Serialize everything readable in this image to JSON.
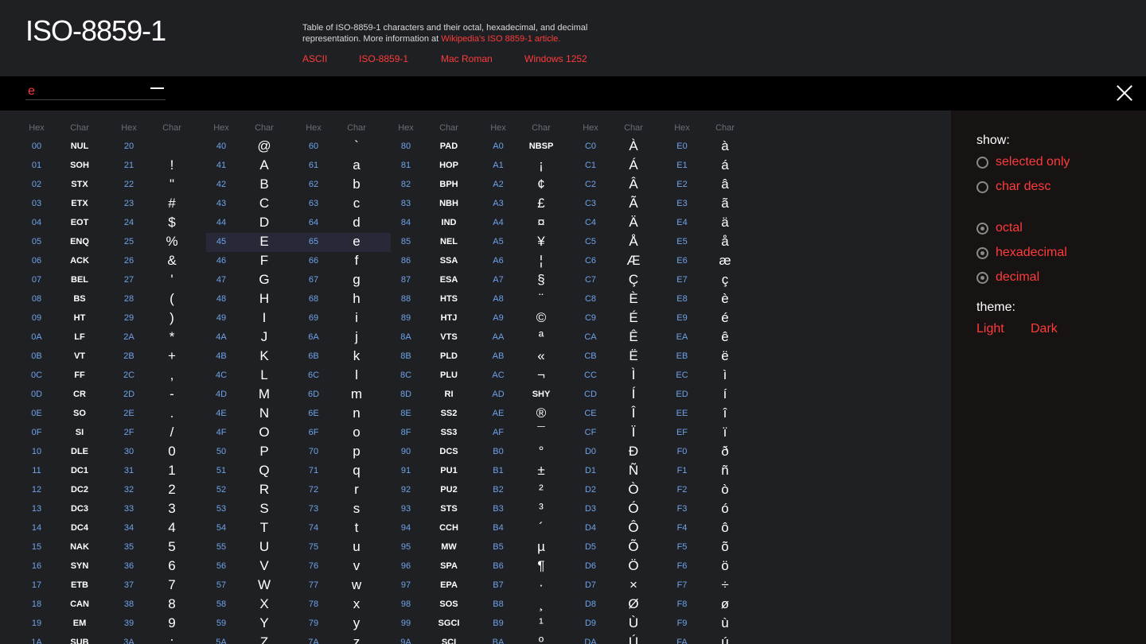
{
  "header": {
    "title": "ISO-8859-1",
    "description": "Table of ISO-8859-1 characters and their octal, hexadecimal, and decimal representation. More information at",
    "description_link": "Wikipedia's ISO 8859-1 article.",
    "links": [
      "ASCII",
      "ISO-8859-1",
      "Mac Roman",
      "Windows 1252"
    ]
  },
  "search": {
    "value": "e",
    "placeholder": ""
  },
  "table": {
    "header_hex": "Hex",
    "header_char": "Char",
    "columns": [
      [
        [
          "00",
          "NUL"
        ],
        [
          "01",
          "SOH"
        ],
        [
          "02",
          "STX"
        ],
        [
          "03",
          "ETX"
        ],
        [
          "04",
          "EOT"
        ],
        [
          "05",
          "ENQ"
        ],
        [
          "06",
          "ACK"
        ],
        [
          "07",
          "BEL"
        ],
        [
          "08",
          "BS"
        ],
        [
          "09",
          "HT"
        ],
        [
          "0A",
          "LF"
        ],
        [
          "0B",
          "VT"
        ],
        [
          "0C",
          "FF"
        ],
        [
          "0D",
          "CR"
        ],
        [
          "0E",
          "SO"
        ],
        [
          "0F",
          "SI"
        ],
        [
          "10",
          "DLE"
        ],
        [
          "11",
          "DC1"
        ],
        [
          "12",
          "DC2"
        ],
        [
          "13",
          "DC3"
        ],
        [
          "14",
          "DC4"
        ],
        [
          "15",
          "NAK"
        ],
        [
          "16",
          "SYN"
        ],
        [
          "17",
          "ETB"
        ],
        [
          "18",
          "CAN"
        ],
        [
          "19",
          "EM"
        ],
        [
          "1A",
          "SUB"
        ]
      ],
      [
        [
          "20",
          ""
        ],
        [
          "21",
          "!"
        ],
        [
          "22",
          "\""
        ],
        [
          "23",
          "#"
        ],
        [
          "24",
          "$"
        ],
        [
          "25",
          "%"
        ],
        [
          "26",
          "&"
        ],
        [
          "27",
          "'"
        ],
        [
          "28",
          "("
        ],
        [
          "29",
          ")"
        ],
        [
          "2A",
          "*"
        ],
        [
          "2B",
          "+"
        ],
        [
          "2C",
          ","
        ],
        [
          "2D",
          "-"
        ],
        [
          "2E",
          "."
        ],
        [
          "2F",
          "/"
        ],
        [
          "30",
          "0"
        ],
        [
          "31",
          "1"
        ],
        [
          "32",
          "2"
        ],
        [
          "33",
          "3"
        ],
        [
          "34",
          "4"
        ],
        [
          "35",
          "5"
        ],
        [
          "36",
          "6"
        ],
        [
          "37",
          "7"
        ],
        [
          "38",
          "8"
        ],
        [
          "39",
          "9"
        ],
        [
          "3A",
          ":"
        ]
      ],
      [
        [
          "40",
          "@"
        ],
        [
          "41",
          "A"
        ],
        [
          "42",
          "B"
        ],
        [
          "43",
          "C"
        ],
        [
          "44",
          "D"
        ],
        [
          "45",
          "E"
        ],
        [
          "46",
          "F"
        ],
        [
          "47",
          "G"
        ],
        [
          "48",
          "H"
        ],
        [
          "49",
          "I"
        ],
        [
          "4A",
          "J"
        ],
        [
          "4B",
          "K"
        ],
        [
          "4C",
          "L"
        ],
        [
          "4D",
          "M"
        ],
        [
          "4E",
          "N"
        ],
        [
          "4F",
          "O"
        ],
        [
          "50",
          "P"
        ],
        [
          "51",
          "Q"
        ],
        [
          "52",
          "R"
        ],
        [
          "53",
          "S"
        ],
        [
          "54",
          "T"
        ],
        [
          "55",
          "U"
        ],
        [
          "56",
          "V"
        ],
        [
          "57",
          "W"
        ],
        [
          "58",
          "X"
        ],
        [
          "59",
          "Y"
        ],
        [
          "5A",
          "Z"
        ]
      ],
      [
        [
          "60",
          "`"
        ],
        [
          "61",
          "a"
        ],
        [
          "62",
          "b"
        ],
        [
          "63",
          "c"
        ],
        [
          "64",
          "d"
        ],
        [
          "65",
          "e"
        ],
        [
          "66",
          "f"
        ],
        [
          "67",
          "g"
        ],
        [
          "68",
          "h"
        ],
        [
          "69",
          "i"
        ],
        [
          "6A",
          "j"
        ],
        [
          "6B",
          "k"
        ],
        [
          "6C",
          "l"
        ],
        [
          "6D",
          "m"
        ],
        [
          "6E",
          "n"
        ],
        [
          "6F",
          "o"
        ],
        [
          "70",
          "p"
        ],
        [
          "71",
          "q"
        ],
        [
          "72",
          "r"
        ],
        [
          "73",
          "s"
        ],
        [
          "74",
          "t"
        ],
        [
          "75",
          "u"
        ],
        [
          "76",
          "v"
        ],
        [
          "77",
          "w"
        ],
        [
          "78",
          "x"
        ],
        [
          "79",
          "y"
        ],
        [
          "7A",
          "z"
        ]
      ],
      [
        [
          "80",
          "PAD"
        ],
        [
          "81",
          "HOP"
        ],
        [
          "82",
          "BPH"
        ],
        [
          "83",
          "NBH"
        ],
        [
          "84",
          "IND"
        ],
        [
          "85",
          "NEL"
        ],
        [
          "86",
          "SSA"
        ],
        [
          "87",
          "ESA"
        ],
        [
          "88",
          "HTS"
        ],
        [
          "89",
          "HTJ"
        ],
        [
          "8A",
          "VTS"
        ],
        [
          "8B",
          "PLD"
        ],
        [
          "8C",
          "PLU"
        ],
        [
          "8D",
          "RI"
        ],
        [
          "8E",
          "SS2"
        ],
        [
          "8F",
          "SS3"
        ],
        [
          "90",
          "DCS"
        ],
        [
          "91",
          "PU1"
        ],
        [
          "92",
          "PU2"
        ],
        [
          "93",
          "STS"
        ],
        [
          "94",
          "CCH"
        ],
        [
          "95",
          "MW"
        ],
        [
          "96",
          "SPA"
        ],
        [
          "97",
          "EPA"
        ],
        [
          "98",
          "SOS"
        ],
        [
          "99",
          "SGCI"
        ],
        [
          "9A",
          "SCI"
        ]
      ],
      [
        [
          "A0",
          "NBSP"
        ],
        [
          "A1",
          "¡"
        ],
        [
          "A2",
          "¢"
        ],
        [
          "A3",
          "£"
        ],
        [
          "A4",
          "¤"
        ],
        [
          "A5",
          "¥"
        ],
        [
          "A6",
          "¦"
        ],
        [
          "A7",
          "§"
        ],
        [
          "A8",
          "¨"
        ],
        [
          "A9",
          "©"
        ],
        [
          "AA",
          "ª"
        ],
        [
          "AB",
          "«"
        ],
        [
          "AC",
          "¬"
        ],
        [
          "AD",
          "SHY"
        ],
        [
          "AE",
          "®"
        ],
        [
          "AF",
          "¯"
        ],
        [
          "B0",
          "°"
        ],
        [
          "B1",
          "±"
        ],
        [
          "B2",
          "²"
        ],
        [
          "B3",
          "³"
        ],
        [
          "B4",
          "´"
        ],
        [
          "B5",
          "µ"
        ],
        [
          "B6",
          "¶"
        ],
        [
          "B7",
          "·"
        ],
        [
          "B8",
          "¸"
        ],
        [
          "B9",
          "¹"
        ],
        [
          "BA",
          "º"
        ]
      ],
      [
        [
          "C0",
          "À"
        ],
        [
          "C1",
          "Á"
        ],
        [
          "C2",
          "Â"
        ],
        [
          "C3",
          "Ã"
        ],
        [
          "C4",
          "Ä"
        ],
        [
          "C5",
          "Å"
        ],
        [
          "C6",
          "Æ"
        ],
        [
          "C7",
          "Ç"
        ],
        [
          "C8",
          "È"
        ],
        [
          "C9",
          "É"
        ],
        [
          "CA",
          "Ê"
        ],
        [
          "CB",
          "Ë"
        ],
        [
          "CC",
          "Ì"
        ],
        [
          "CD",
          "Í"
        ],
        [
          "CE",
          "Î"
        ],
        [
          "CF",
          "Ï"
        ],
        [
          "D0",
          "Ð"
        ],
        [
          "D1",
          "Ñ"
        ],
        [
          "D2",
          "Ò"
        ],
        [
          "D3",
          "Ó"
        ],
        [
          "D4",
          "Ô"
        ],
        [
          "D5",
          "Õ"
        ],
        [
          "D6",
          "Ö"
        ],
        [
          "D7",
          "×"
        ],
        [
          "D8",
          "Ø"
        ],
        [
          "D9",
          "Ù"
        ],
        [
          "DA",
          "Ú"
        ]
      ],
      [
        [
          "E0",
          "à"
        ],
        [
          "E1",
          "á"
        ],
        [
          "E2",
          "â"
        ],
        [
          "E3",
          "ã"
        ],
        [
          "E4",
          "ä"
        ],
        [
          "E5",
          "å"
        ],
        [
          "E6",
          "æ"
        ],
        [
          "E7",
          "ç"
        ],
        [
          "E8",
          "è"
        ],
        [
          "E9",
          "é"
        ],
        [
          "EA",
          "ê"
        ],
        [
          "EB",
          "ë"
        ],
        [
          "EC",
          "ì"
        ],
        [
          "ED",
          "í"
        ],
        [
          "EE",
          "î"
        ],
        [
          "EF",
          "ï"
        ],
        [
          "F0",
          "ð"
        ],
        [
          "F1",
          "ñ"
        ],
        [
          "F2",
          "ò"
        ],
        [
          "F3",
          "ó"
        ],
        [
          "F4",
          "ô"
        ],
        [
          "F5",
          "õ"
        ],
        [
          "F6",
          "ö"
        ],
        [
          "F7",
          "÷"
        ],
        [
          "F8",
          "ø"
        ],
        [
          "F9",
          "ù"
        ],
        [
          "FA",
          "ú"
        ]
      ]
    ],
    "control_names": [
      "NUL",
      "SOH",
      "STX",
      "ETX",
      "EOT",
      "ENQ",
      "ACK",
      "BEL",
      "BS",
      "HT",
      "LF",
      "VT",
      "FF",
      "CR",
      "SO",
      "SI",
      "DLE",
      "DC1",
      "DC2",
      "DC3",
      "DC4",
      "NAK",
      "SYN",
      "ETB",
      "CAN",
      "EM",
      "SUB",
      "PAD",
      "HOP",
      "BPH",
      "NBH",
      "IND",
      "NEL",
      "SSA",
      "ESA",
      "HTS",
      "HTJ",
      "VTS",
      "PLD",
      "PLU",
      "RI",
      "SS2",
      "SS3",
      "DCS",
      "PU1",
      "PU2",
      "STS",
      "CCH",
      "MW",
      "SPA",
      "EPA",
      "SOS",
      "SGCI",
      "SCI",
      "NBSP",
      "SHY"
    ],
    "highlighted_hex": [
      "45",
      "65"
    ]
  },
  "sidebar": {
    "show_label": "show:",
    "show_options": [
      {
        "label": "selected only",
        "checked": false
      },
      {
        "label": "char desc",
        "checked": false
      }
    ],
    "format_options": [
      {
        "label": "octal",
        "checked": true
      },
      {
        "label": "hexadecimal",
        "checked": true
      },
      {
        "label": "decimal",
        "checked": true
      }
    ],
    "theme_label": "theme:",
    "themes": [
      "Light",
      "Dark"
    ]
  },
  "colors": {
    "accent": "#ff3b3b",
    "hex_text": "#6fa3e8",
    "background": "#1f2023",
    "search_bar": "#000000",
    "sidebar_bg": "#171313",
    "row_highlight": "#272838"
  }
}
